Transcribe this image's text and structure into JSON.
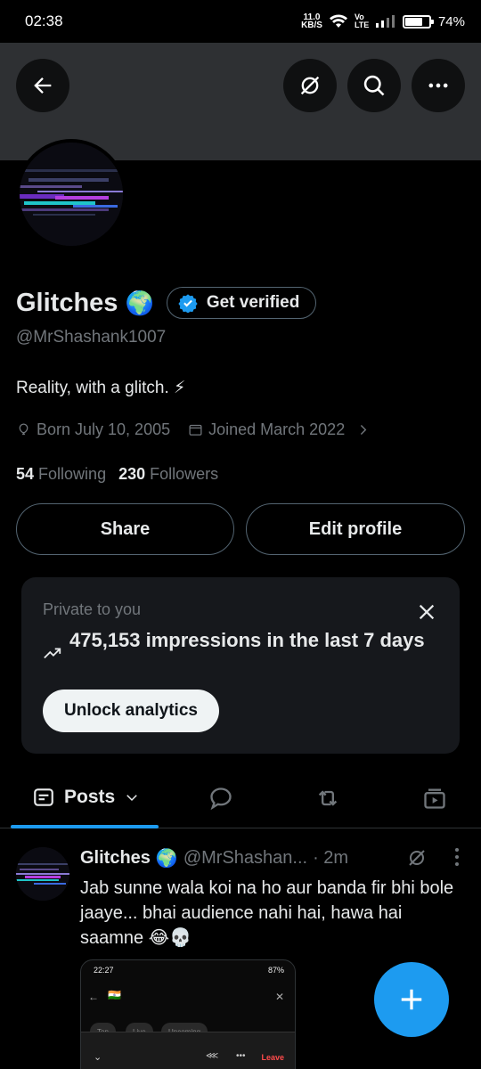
{
  "status_bar": {
    "time": "02:38",
    "net_speed": "11.0",
    "net_unit": "KB/S",
    "volte": "Vo LTE",
    "battery_pct": "74%",
    "battery_level": 0.74
  },
  "header": {
    "back_icon": "arrow-left-icon",
    "grok_icon": "grok-icon",
    "search_icon": "search-icon",
    "more_icon": "more-horizontal-icon",
    "banner_color": "#2e3033"
  },
  "profile": {
    "name": "Glitches",
    "name_emoji": "🌍",
    "verify_label": "Get verified",
    "handle": "@MrShashank1007",
    "bio": "Reality, with a glitch. ⚡",
    "born": "Born July 10, 2005",
    "joined": "Joined March 2022",
    "following_count": "54",
    "following_label": "Following",
    "followers_count": "230",
    "followers_label": "Followers",
    "share_label": "Share",
    "edit_label": "Edit profile"
  },
  "analytics_card": {
    "private_label": "Private to you",
    "impressions_text": "475,153 impressions in the last 7 days",
    "unlock_label": "Unlock analytics"
  },
  "tabs": {
    "posts_label": "Posts",
    "accent": "#1d9bf0"
  },
  "post": {
    "name": "Glitches",
    "name_emoji": "🌍",
    "handle": "@MrShashan...",
    "time": "· 2m",
    "text": "Jab sunne wala koi na ho aur banda fir bhi bole jaaye... bhai audience nahi hai, hawa hai saamne 😂💀",
    "media": {
      "time": "22:27",
      "battery": "87%",
      "flag": "🇮🇳",
      "chip1": "Top",
      "chip2": "Live",
      "chip3": "Upcoming",
      "leave_label": "Leave"
    }
  },
  "fab": {
    "icon": "plus-icon",
    "color": "#1d9bf0"
  }
}
